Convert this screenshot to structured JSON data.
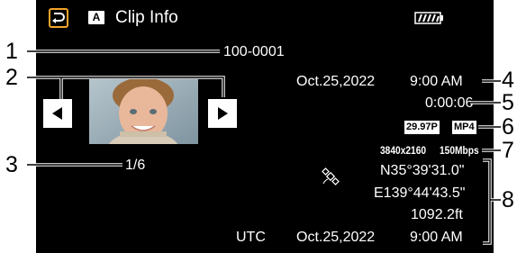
{
  "screen": {
    "title": "Clip Info",
    "mode_badge": "A",
    "clip_number": "100-0001",
    "date_time": {
      "date": "Oct.25,2022",
      "time": "9:00 AM"
    },
    "duration": "0:00:06",
    "frame_rate": "29.97P",
    "format": "MP4",
    "resolution": "3840x2160",
    "bitrate": "150Mbps",
    "page_index": "1/6",
    "gps": {
      "latitude": "N35°39'31.0\"",
      "longitude": "E139°44'43.5\"",
      "altitude": "1092.2ft",
      "utc_label": "UTC",
      "utc_date": "Oct.25,2022",
      "utc_time": "9:00 AM"
    },
    "icons": {
      "back": "back-arrow-icon",
      "battery": "battery-icon",
      "prev": "triangle-left-icon",
      "next": "triangle-right-icon",
      "gps": "satellite-icon"
    },
    "colors": {
      "back_button_border": "#f3a42a",
      "background": "#000000"
    }
  },
  "callouts": [
    "1",
    "2",
    "3",
    "4",
    "5",
    "6",
    "7",
    "8"
  ]
}
